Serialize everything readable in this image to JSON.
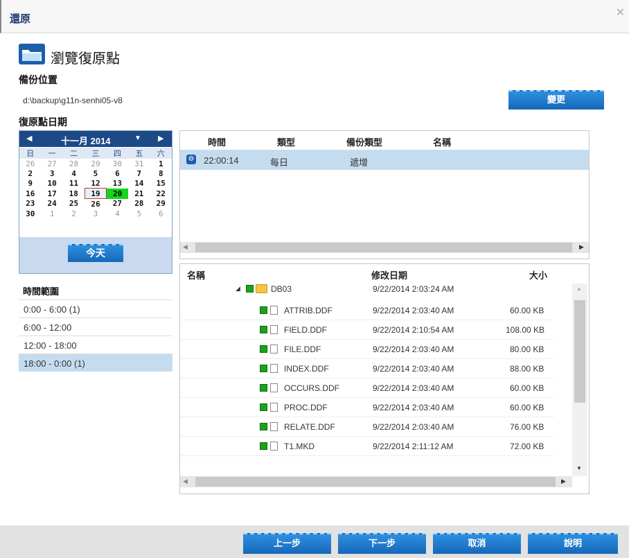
{
  "dialog": {
    "title": "還原",
    "close": "✕"
  },
  "heading": "瀏覽復原點",
  "backup_location": {
    "label": "備份位置",
    "path": "d:\\backup\\g11n-senhi05-v8",
    "change_button": "變更"
  },
  "recovery_date_label": "復原點日期",
  "calendar": {
    "month_label": "十一月 2014",
    "weekdays": [
      "日",
      "一",
      "二",
      "三",
      "四",
      "五",
      "六"
    ],
    "weeks": [
      [
        "26",
        "27",
        "28",
        "29",
        "30",
        "31",
        "1"
      ],
      [
        "2",
        "3",
        "4",
        "5",
        "6",
        "7",
        "8"
      ],
      [
        "9",
        "10",
        "11",
        "12",
        "13",
        "14",
        "15"
      ],
      [
        "16",
        "17",
        "18",
        "19",
        "20",
        "21",
        "22"
      ],
      [
        "23",
        "24",
        "25",
        "26",
        "27",
        "28",
        "29"
      ],
      [
        "30",
        "1",
        "2",
        "3",
        "4",
        "5",
        "6"
      ]
    ],
    "selected_day": "19",
    "highlighted_day": "20",
    "today_button": "今天"
  },
  "time_range": {
    "label": "時間範圍",
    "items": [
      "0:00 - 6:00   (1)",
      "6:00 - 12:00",
      "12:00 - 18:00",
      "18:00 - 0:00   (1)"
    ],
    "selected_index": 3
  },
  "recovery_points": {
    "columns": [
      "時間",
      "類型",
      "備份類型",
      "名稱"
    ],
    "rows": [
      {
        "time": "22:00:14",
        "type": "每日",
        "backup_type": "遞增",
        "name": ""
      }
    ]
  },
  "files": {
    "columns": [
      "名稱",
      "修改日期",
      "大小"
    ],
    "folder": {
      "name": "DB03",
      "modified": "9/22/2014 2:03:24 AM"
    },
    "rows": [
      {
        "name": "ATTRIB.DDF",
        "modified": "9/22/2014 2:03:40 AM",
        "size": "60.00 KB"
      },
      {
        "name": "FIELD.DDF",
        "modified": "9/22/2014 2:10:54 AM",
        "size": "108.00 KB"
      },
      {
        "name": "FILE.DDF",
        "modified": "9/22/2014 2:03:40 AM",
        "size": "80.00 KB"
      },
      {
        "name": "INDEX.DDF",
        "modified": "9/22/2014 2:03:40 AM",
        "size": "88.00 KB"
      },
      {
        "name": "OCCURS.DDF",
        "modified": "9/22/2014 2:03:40 AM",
        "size": "60.00 KB"
      },
      {
        "name": "PROC.DDF",
        "modified": "9/22/2014 2:03:40 AM",
        "size": "60.00 KB"
      },
      {
        "name": "RELATE.DDF",
        "modified": "9/22/2014 2:03:40 AM",
        "size": "76.00 KB"
      },
      {
        "name": "T1.MKD",
        "modified": "9/22/2014 2:11:12 AM",
        "size": "72.00 KB"
      }
    ]
  },
  "footer": {
    "prev": "上一步",
    "next": "下一步",
    "cancel": "取消",
    "help": "說明"
  },
  "colors": {
    "accent": "#1d4a87",
    "button": "#1a78cf",
    "selection": "#c5dcef",
    "today": "#13d61a"
  }
}
